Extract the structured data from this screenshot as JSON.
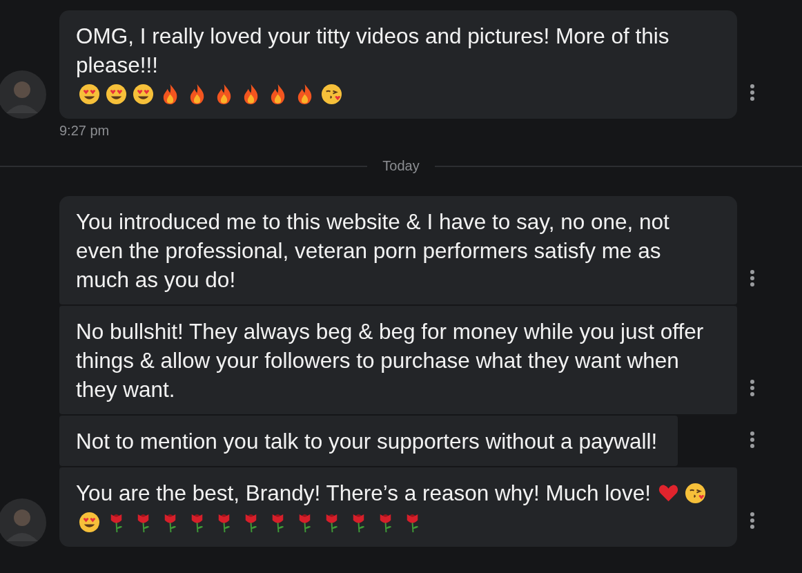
{
  "earlier": {
    "messages": [
      {
        "text": "OMG, I really loved your titty videos and pictures! More of this please!!!",
        "emojis": [
          {
            "kind": "heart-eyes"
          },
          {
            "kind": "heart-eyes"
          },
          {
            "kind": "heart-eyes"
          },
          {
            "kind": "fire"
          },
          {
            "kind": "fire"
          },
          {
            "kind": "fire"
          },
          {
            "kind": "fire"
          },
          {
            "kind": "fire"
          },
          {
            "kind": "fire"
          },
          {
            "kind": "kiss"
          }
        ]
      }
    ],
    "time": "9:27 pm"
  },
  "day_divider": {
    "label": "Today"
  },
  "today": {
    "messages": [
      {
        "text": "You introduced me to this website & I have to say, no one, not even the professional, veteran porn performers satisfy me as much as you do!"
      },
      {
        "text": "No bullshit! They always beg & beg for money while you just offer things & allow your followers to purchase what they want when they want."
      },
      {
        "text": "Not to mention you talk to your supporters without a paywall!"
      },
      {
        "text": "You are the best, Brandy! There’s a reason why! Much love!",
        "emojis": [
          {
            "kind": "heart"
          },
          {
            "kind": "kiss"
          },
          {
            "kind": "heart-eyes"
          },
          {
            "kind": "rose"
          },
          {
            "kind": "rose"
          },
          {
            "kind": "rose"
          },
          {
            "kind": "rose"
          },
          {
            "kind": "rose"
          },
          {
            "kind": "rose"
          },
          {
            "kind": "rose"
          },
          {
            "kind": "rose"
          },
          {
            "kind": "rose"
          },
          {
            "kind": "rose"
          },
          {
            "kind": "rose"
          },
          {
            "kind": "rose"
          }
        ]
      }
    ]
  }
}
